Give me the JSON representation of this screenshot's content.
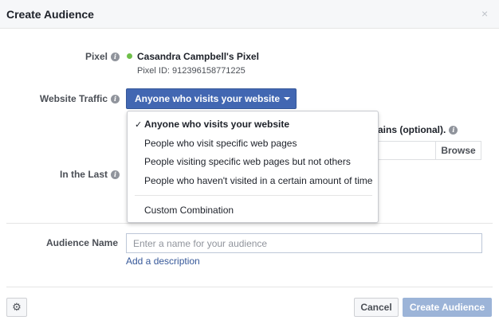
{
  "dialog": {
    "title": "Create Audience",
    "close_glyph": "×"
  },
  "pixel": {
    "label": "Pixel",
    "name": "Casandra Campbell's Pixel",
    "id_text": "Pixel ID: 912396158771225",
    "status_color": "#6fbf4a"
  },
  "website_traffic": {
    "label": "Website Traffic",
    "selected": "Anyone who visits your website",
    "options": [
      "Anyone who visits your website",
      "People who visit specific web pages",
      "People visiting specific web pages but not others",
      "People who haven't visited in a certain amount of time",
      "Custom Combination"
    ]
  },
  "background": {
    "partial_label": "ains (optional).",
    "browse_label": "Browse"
  },
  "in_the_last": {
    "label": "In the Last"
  },
  "audience_name": {
    "label": "Audience Name",
    "placeholder": "Enter a name for your audience",
    "value": "",
    "add_description": "Add a description"
  },
  "footer": {
    "settings_icon": "gear-icon",
    "cancel_label": "Cancel",
    "create_label": "Create Audience"
  },
  "colors": {
    "primary_button": "#4267b2",
    "disabled_button": "#9cb4d8",
    "link": "#365899"
  }
}
